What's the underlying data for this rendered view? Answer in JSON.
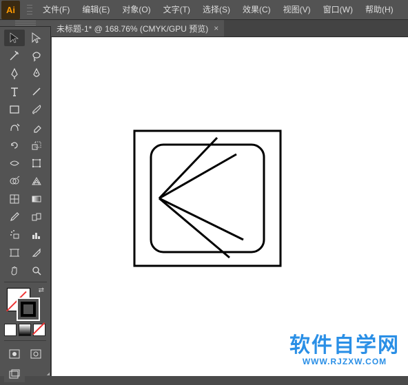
{
  "app": {
    "logo": "Ai"
  },
  "menu": {
    "file": "文件(F)",
    "edit": "编辑(E)",
    "object": "对象(O)",
    "type": "文字(T)",
    "select": "选择(S)",
    "effect": "效果(C)",
    "view": "视图(V)",
    "window": "窗口(W)",
    "help": "帮助(H)"
  },
  "tab": {
    "title": "未标题-1* @ 168.76% (CMYK/GPU 预览)",
    "close": "×"
  },
  "watermark": {
    "line1": "软件自学网",
    "line2": "WWW.RJZXW.COM"
  },
  "tool_names": [
    "selection-tool",
    "direct-selection-tool",
    "magic-wand-tool",
    "lasso-tool",
    "pen-tool",
    "curvature-tool",
    "type-tool",
    "line-tool",
    "rectangle-tool",
    "paintbrush-tool",
    "shaper-tool",
    "eraser-tool",
    "rotate-tool",
    "scale-tool",
    "width-tool",
    "free-transform-tool",
    "shape-builder-tool",
    "perspective-grid-tool",
    "mesh-tool",
    "gradient-tool",
    "eyedropper-tool",
    "blend-tool",
    "symbol-sprayer-tool",
    "column-graph-tool",
    "artboard-tool",
    "slice-tool",
    "hand-tool",
    "zoom-tool"
  ]
}
